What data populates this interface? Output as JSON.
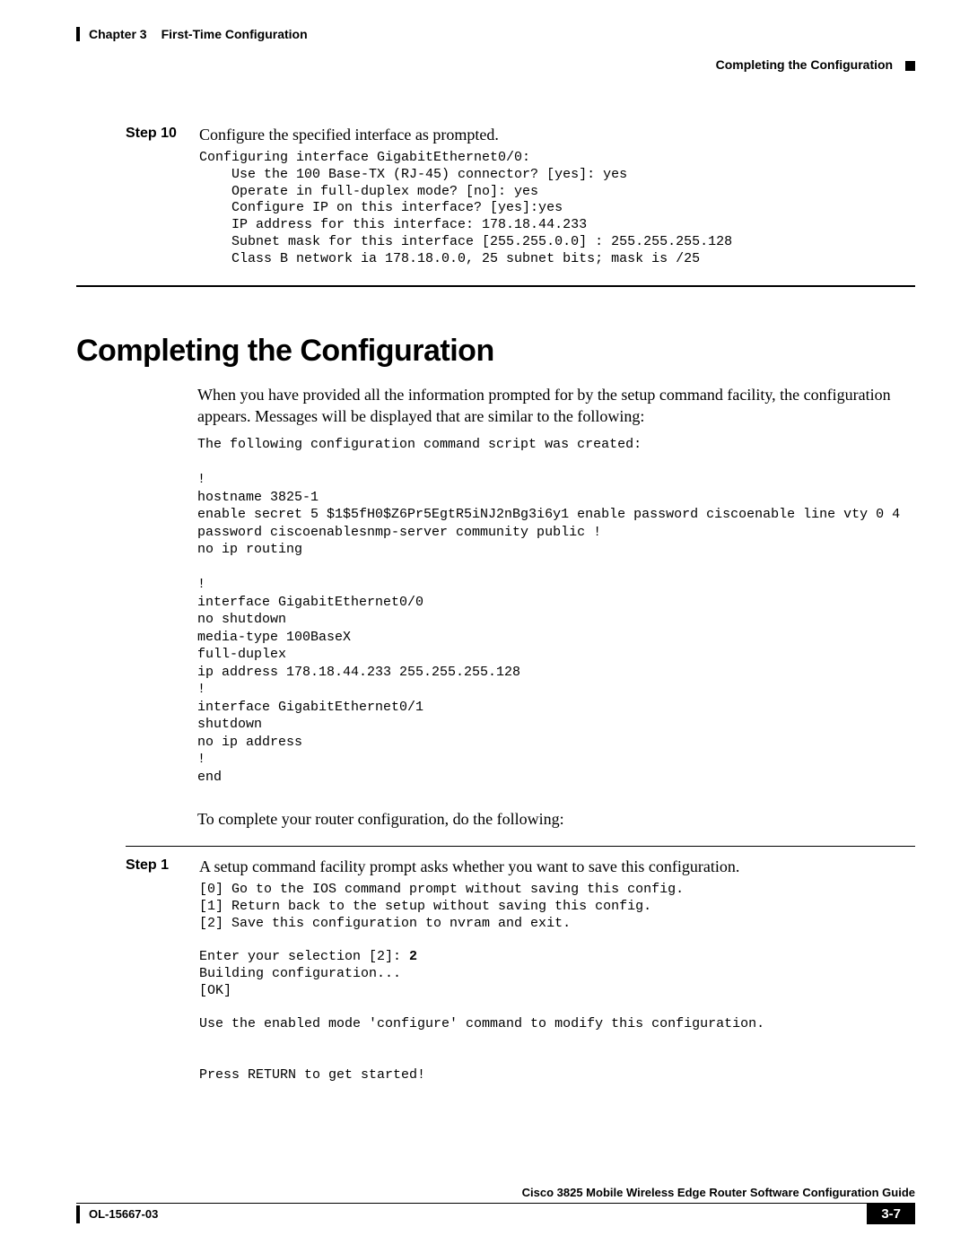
{
  "header": {
    "chapter_label": "Chapter 3",
    "chapter_title": "First-Time Configuration",
    "section_right": "Completing the Configuration"
  },
  "step10": {
    "label": "Step 10",
    "text": "Configure the specified interface as prompted.",
    "code": "Configuring interface GigabitEthernet0/0:\n    Use the 100 Base-TX (RJ-45) connector? [yes]: yes\n    Operate in full-duplex mode? [no]: yes\n    Configure IP on this interface? [yes]:yes\n    IP address for this interface: 178.18.44.233\n    Subnet mask for this interface [255.255.0.0] : 255.255.255.128\n    Class B network ia 178.18.0.0, 25 subnet bits; mask is /25"
  },
  "section_title": "Completing the Configuration",
  "intro_para": "When you have provided all the information prompted for by the setup command facility, the configuration appears. Messages will be displayed that are similar to the following:",
  "config_script": "The following configuration command script was created:\n\n!\nhostname 3825-1\nenable secret 5 $1$5fH0$Z6Pr5EgtR5iNJ2nBg3i6y1 enable password ciscoenable line vty 0 4 password ciscoenablesnmp-server community public !\nno ip routing\n\n!\ninterface GigabitEthernet0/0\nno shutdown\nmedia-type 100BaseX\nfull-duplex\nip address 178.18.44.233 255.255.255.128\n!\ninterface GigabitEthernet0/1\nshutdown\nno ip address\n!\nend",
  "complete_para": "To complete your router configuration, do the following:",
  "step1": {
    "label": "Step 1",
    "text": "A setup command facility prompt asks whether you want to save this configuration.",
    "code_pre": "[0] Go to the IOS command prompt without saving this config.\n[1] Return back to the setup without saving this config.\n[2] Save this configuration to nvram and exit.\n\nEnter your selection [2]: ",
    "selection_bold": "2",
    "code_post": "\nBuilding configuration...\n[OK]\n\nUse the enabled mode 'configure' command to modify this configuration.\n\n\nPress RETURN to get started!"
  },
  "footer": {
    "guide": "Cisco 3825 Mobile Wireless Edge Router Software Configuration Guide",
    "docid": "OL-15667-03",
    "pagenum": "3-7"
  }
}
